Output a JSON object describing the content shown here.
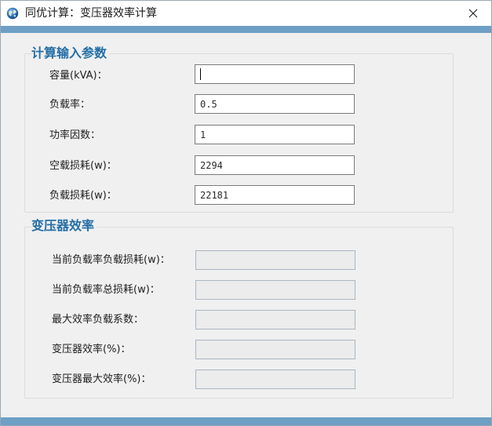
{
  "window": {
    "title": "同优计算：变压器效率计算",
    "app_icon": "globe-icon",
    "close_icon": "close-icon",
    "accent": "#6e9fc4",
    "group_title_color": "#246ea6"
  },
  "input_group": {
    "title": "计算输入参数",
    "fields": [
      {
        "label": "容量(kVA)：",
        "value": ""
      },
      {
        "label": "负载率：",
        "value": "0.5"
      },
      {
        "label": "功率因数：",
        "value": "1"
      },
      {
        "label": "空载损耗(w)：",
        "value": "2294"
      },
      {
        "label": "负载损耗(w)：",
        "value": "22181"
      }
    ]
  },
  "output_group": {
    "title": "变压器效率",
    "fields": [
      {
        "label": "当前负载率负载损耗(w)：",
        "value": ""
      },
      {
        "label": "当前负载率总损耗(w)：",
        "value": ""
      },
      {
        "label": "最大效率负载系数：",
        "value": ""
      },
      {
        "label": "变压器效率(%)：",
        "value": ""
      },
      {
        "label": "变压器最大效率(%)：",
        "value": ""
      }
    ]
  }
}
